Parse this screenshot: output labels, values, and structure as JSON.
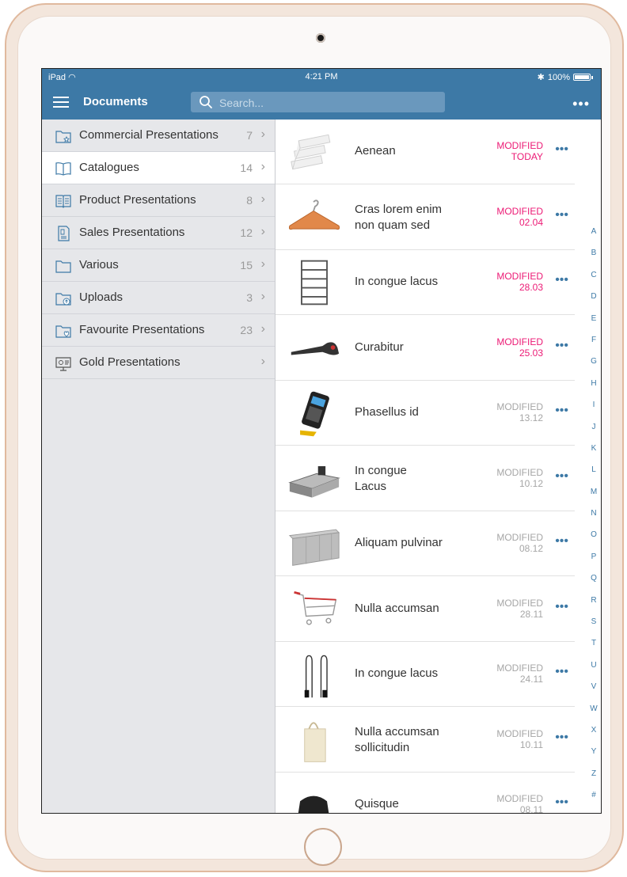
{
  "status": {
    "left": "iPad",
    "time": "4:21 PM",
    "battery": "100%"
  },
  "nav": {
    "title": "Documents",
    "search_placeholder": "Search...",
    "more": "•••"
  },
  "sidebar": {
    "items": [
      {
        "label": "Commercial Presentations",
        "count": "7",
        "icon": "folder-star-icon"
      },
      {
        "label": "Catalogues",
        "count": "14",
        "icon": "book-icon"
      },
      {
        "label": "Product Presentations",
        "count": "8",
        "icon": "open-book-icon"
      },
      {
        "label": "Sales Presentations",
        "count": "12",
        "icon": "document-dollar-icon"
      },
      {
        "label": "Various",
        "count": "15",
        "icon": "folder-icon"
      },
      {
        "label": "Uploads",
        "count": "3",
        "icon": "folder-upload-icon"
      },
      {
        "label": "Favourite Presentations",
        "count": "23",
        "icon": "folder-heart-icon"
      },
      {
        "label": "Gold Presentations",
        "count": "",
        "icon": "presentation-board-icon"
      }
    ]
  },
  "documents": [
    {
      "title": "Aenean",
      "title2": "",
      "mod": "MODIFIED",
      "date": "TODAY",
      "recent": true
    },
    {
      "title": "Cras lorem enim",
      "title2": "non quam sed",
      "mod": "MODIFIED",
      "date": "02.04",
      "recent": true
    },
    {
      "title": "In congue lacus",
      "title2": "",
      "mod": "MODIFIED",
      "date": "28.03",
      "recent": true
    },
    {
      "title": "Curabitur",
      "title2": "",
      "mod": "MODIFIED",
      "date": "25.03",
      "recent": true
    },
    {
      "title": "Phasellus id",
      "title2": "",
      "mod": "MODIFIED",
      "date": "13.12",
      "recent": false
    },
    {
      "title": "In congue",
      "title2": "Lacus",
      "mod": "MODIFIED",
      "date": "10.12",
      "recent": false
    },
    {
      "title": "Aliquam pulvinar",
      "title2": "",
      "mod": "MODIFIED",
      "date": "08.12",
      "recent": false
    },
    {
      "title": "Nulla accumsan",
      "title2": "",
      "mod": "MODIFIED",
      "date": "28.11",
      "recent": false
    },
    {
      "title": "In congue lacus",
      "title2": "",
      "mod": "MODIFIED",
      "date": "24.11",
      "recent": false
    },
    {
      "title": "Nulla accumsan",
      "title2": "sollicitudin",
      "mod": "MODIFIED",
      "date": "10.11",
      "recent": false
    },
    {
      "title": "Quisque",
      "title2": "",
      "mod": "MODIFIED",
      "date": "08.11",
      "recent": false
    }
  ],
  "row_more": "•••",
  "alphabet": [
    "A",
    "B",
    "C",
    "D",
    "E",
    "F",
    "G",
    "H",
    "I",
    "J",
    "K",
    "L",
    "M",
    "N",
    "O",
    "P",
    "Q",
    "R",
    "S",
    "T",
    "U",
    "V",
    "W",
    "X",
    "Y",
    "Z",
    "#"
  ],
  "colors": {
    "accent": "#3d79a6",
    "recent": "#ec1a75",
    "old": "#a6a6a6",
    "sidebar_bg": "#e6e7ea"
  }
}
